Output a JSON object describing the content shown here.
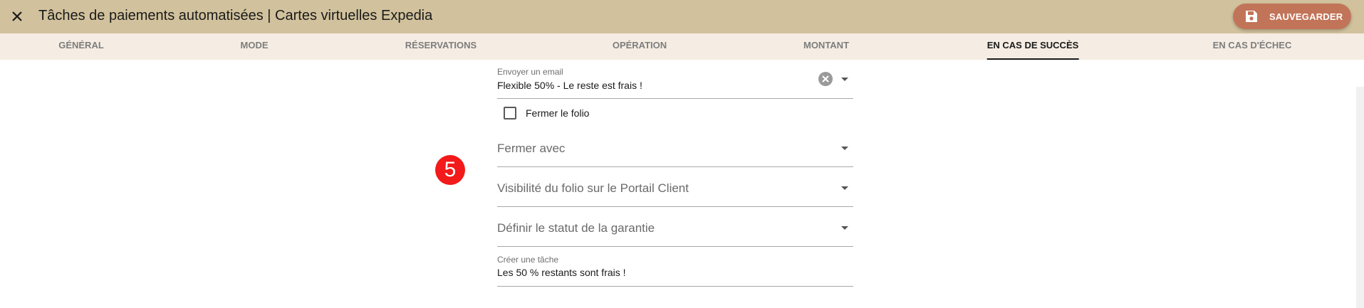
{
  "header": {
    "title": "Tâches de paiements automatisées | Cartes virtuelles Expedia",
    "close_icon": "close-icon",
    "save_label": "SAUVEGARDER",
    "save_icon": "floppy-disk-icon",
    "background_color": "#d1c29d",
    "save_button_color": "#c27458"
  },
  "tabs": [
    {
      "label": "GÉNÉRAL",
      "active": false
    },
    {
      "label": "MODE",
      "active": false
    },
    {
      "label": "RÉSERVATIONS",
      "active": false
    },
    {
      "label": "OPÉRATION",
      "active": false
    },
    {
      "label": "MONTANT",
      "active": false
    },
    {
      "label": "EN CAS DE SUCCÈS",
      "active": true
    },
    {
      "label": "EN CAS D'ÉCHEC",
      "active": false
    }
  ],
  "step_badge": "5",
  "form": {
    "send_email": {
      "label": "Envoyer un email",
      "value": "Flexible 50% - Le reste est frais !"
    },
    "close_folio": {
      "label": "Fermer le folio",
      "checked": false
    },
    "close_with": {
      "placeholder": "Fermer avec"
    },
    "folio_visibility": {
      "placeholder": "Visibilité du folio sur le Portail Client"
    },
    "guarantee_status": {
      "placeholder": "Définir le statut de la garantie"
    },
    "create_task": {
      "label": "Créer une tâche",
      "value": "Les 50 % restants sont frais !"
    }
  }
}
